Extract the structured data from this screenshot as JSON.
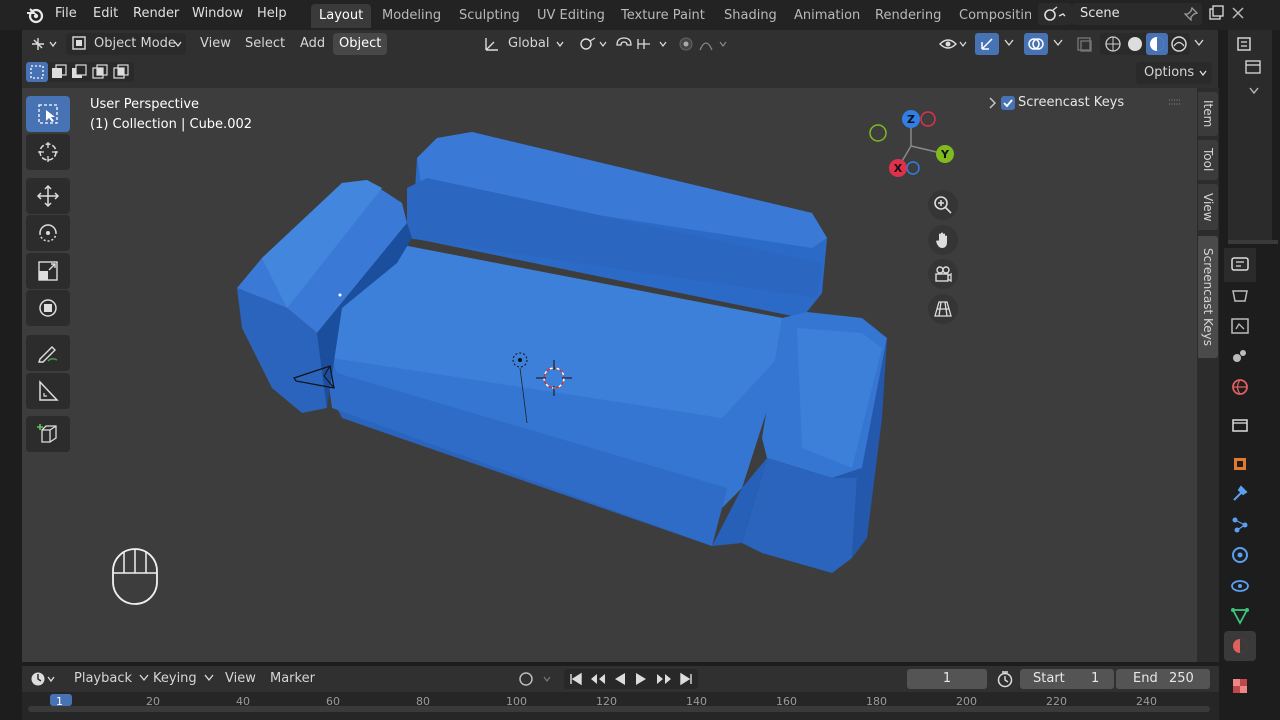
{
  "menu": {
    "file": "File",
    "edit": "Edit",
    "render": "Render",
    "window": "Window",
    "help": "Help"
  },
  "workspaces": [
    {
      "label": "Layout",
      "active": true
    },
    {
      "label": "Modeling",
      "active": false
    },
    {
      "label": "Sculpting",
      "active": false
    },
    {
      "label": "UV Editing",
      "active": false
    },
    {
      "label": "Texture Paint",
      "active": false
    },
    {
      "label": "Shading",
      "active": false
    },
    {
      "label": "Animation",
      "active": false
    },
    {
      "label": "Rendering",
      "active": false
    },
    {
      "label": "Compositing",
      "active": false
    }
  ],
  "scene": {
    "name": "Scene"
  },
  "header": {
    "mode": "Object Mode",
    "view": "View",
    "select": "Select",
    "add": "Add",
    "object": "Object",
    "transform_orientation": "Global",
    "options": "Options"
  },
  "viewport": {
    "perspective": "User Perspective",
    "collection": "(1) Collection | Cube.002",
    "accent": "#4772b3",
    "sofa_color": "#2f6fd0"
  },
  "gizmo": {
    "z": "Z",
    "x": "X",
    "y": "Y",
    "z_color": "#2f7fe6",
    "x_color": "#e0314b",
    "y_color": "#7fba1f"
  },
  "npanel": {
    "tabs": [
      "Item",
      "Tool",
      "View",
      "Screencast Keys"
    ],
    "screencast_label": "Screencast Keys"
  },
  "timeline": {
    "playback": "Playback",
    "keying": "Keying",
    "view": "View",
    "marker": "Marker",
    "current_frame": "1",
    "start_label": "Start",
    "start_value": "1",
    "end_label": "End",
    "end_value": "250",
    "ruler_ticks": [
      "1",
      "20",
      "40",
      "60",
      "80",
      "100",
      "120",
      "140",
      "160",
      "180",
      "200",
      "220",
      "240"
    ]
  }
}
